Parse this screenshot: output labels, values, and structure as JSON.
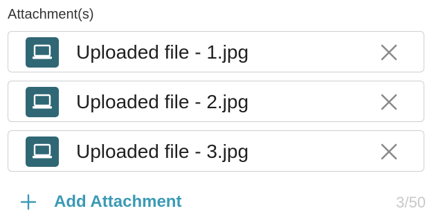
{
  "attachments": {
    "label": "Attachment(s)",
    "files": [
      {
        "name": "Uploaded file - 1.jpg",
        "icon": "laptop-icon"
      },
      {
        "name": "Uploaded file - 2.jpg",
        "icon": "laptop-icon"
      },
      {
        "name": "Uploaded file - 3.jpg",
        "icon": "laptop-icon"
      }
    ],
    "remove_icon": "close-icon",
    "add_label": "Add Attachment",
    "add_icon": "plus-icon",
    "counter": "3/50"
  },
  "colors": {
    "icon_tile": "#2f6775",
    "accent": "#3b9ab5",
    "border": "#cfcfcf",
    "counter": "#c8c8c8",
    "text": "#1f1f1f"
  }
}
